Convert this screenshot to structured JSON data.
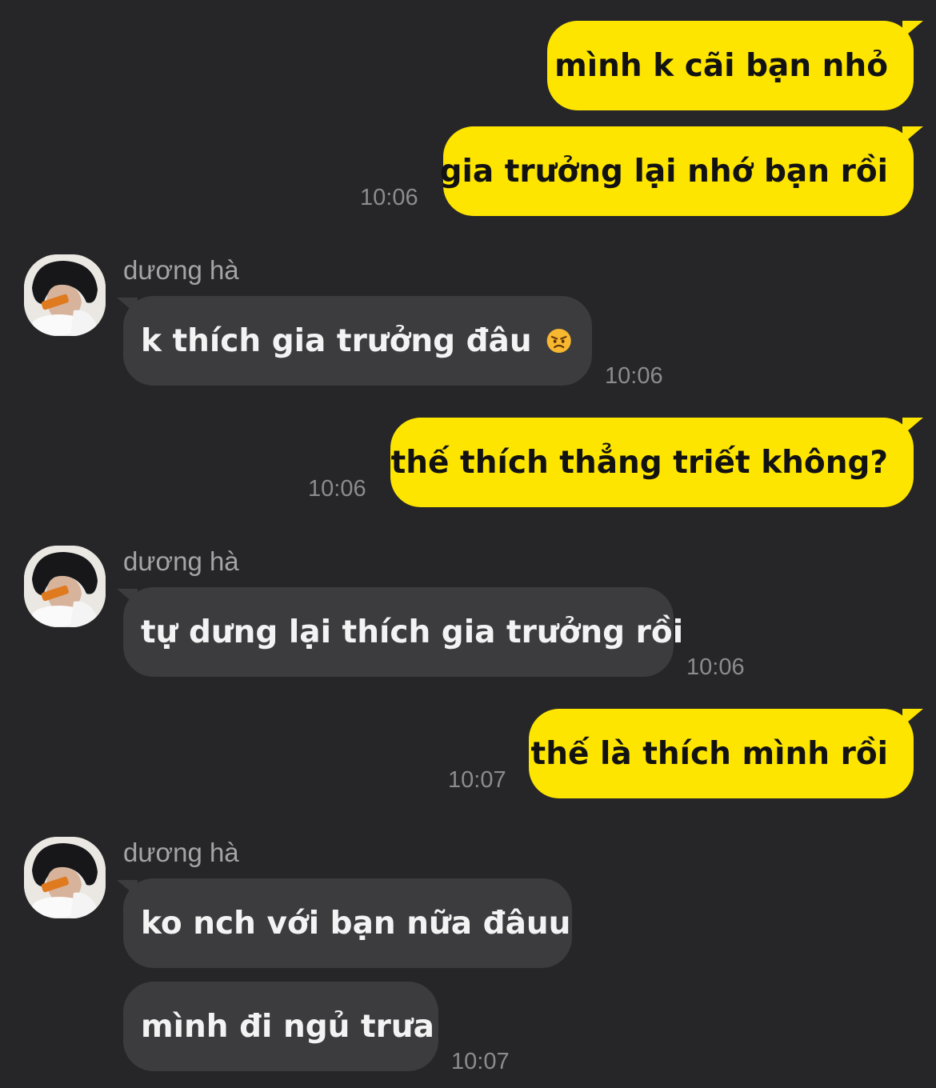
{
  "conversation": {
    "contact_name": "dương hà",
    "messages": [
      {
        "from": "me",
        "text": "mình k cãi bạn nhỏ",
        "time": ""
      },
      {
        "from": "me",
        "text": "gia trưởng lại nhớ bạn rồi",
        "time": "10:06"
      },
      {
        "from": "contact",
        "text": "k thích gia trưởng đâu",
        "emoji": "angry-face-emoji",
        "time": "10:06"
      },
      {
        "from": "me",
        "text": "thế thích thẳng triết không?",
        "time": "10:06"
      },
      {
        "from": "contact",
        "text": "tự dưng lại thích gia trưởng rồi",
        "time": "10:06"
      },
      {
        "from": "me",
        "text": "thế là thích mình rồi",
        "time": "10:07"
      },
      {
        "from": "contact",
        "text": "ko nch với bạn nữa đâuu",
        "time": ""
      },
      {
        "from": "contact",
        "text": "mình đi ngủ trưa",
        "time": "10:07"
      }
    ]
  },
  "colors": {
    "background": "#262628",
    "my_bubble": "#fee500",
    "their_bubble": "#3c3c3f",
    "timestamp": "#8c8c8e"
  }
}
